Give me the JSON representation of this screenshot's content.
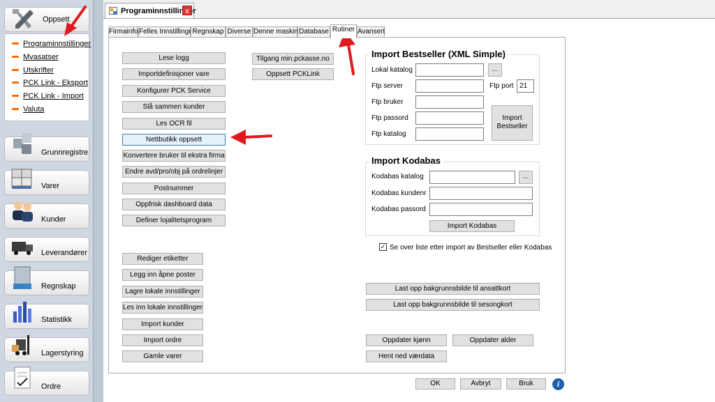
{
  "sidebar": {
    "top_button": "Oppsett",
    "submenu": [
      "Programinnstillinger",
      "Mvasatser",
      "Utskrifter",
      "PCK Link - Eksport",
      "PCK Link - Import",
      "Valuta"
    ],
    "nav": [
      "Grunnregistre",
      "Varer",
      "Kunder",
      "Leverandører",
      "Regnskap",
      "Statistikk",
      "Lagerstyring",
      "Ordre"
    ]
  },
  "document_tab": {
    "title": "Programinnstillinger",
    "close": "x"
  },
  "tabs": [
    "Firmainfo",
    "Felles Innstillinger",
    "Regnskap",
    "Diverse",
    "Denne maskin",
    "Database",
    "Rutiner",
    "Avansert"
  ],
  "active_tab": "Rutiner",
  "left_buttons": [
    "Lese logg",
    "Importdefinisjoner vare",
    "Konfigurer PCK Service",
    "Slå sammen kunder",
    "Les OCR fil",
    "Nettbutikk oppsett",
    "Konvertere bruker til ekstra firma",
    "Endre avd/pro/obj på ordrelinjer",
    "Postnummer",
    "Oppfrisk dashboard data",
    "Definer lojalitetsprogram"
  ],
  "left_buttons2": [
    "Rediger etiketter",
    "Legg inn åpne poster",
    "Lagre lokale innstillinger",
    "Les inn  lokale innstillinger",
    "Import kunder",
    "Import ordre",
    "Gamle varer"
  ],
  "mid_buttons": [
    "Tilgang min.pckasse.no",
    "Oppsett PCKLink"
  ],
  "bestseller": {
    "title": "Import Bestseller (XML Simple)",
    "lokal_katalog": "Lokal katalog",
    "browse": "...",
    "ftp_server": "Ftp server",
    "ftp_port_label": "Ftp port",
    "ftp_port_value": "21",
    "ftp_bruker": "Ftp bruker",
    "ftp_passord": "Ftp passord",
    "ftp_katalog": "Ftp katalog",
    "import_button": "Import Bestseller"
  },
  "kodabas": {
    "title": "Import Kodabas",
    "katalog": "Kodabas katalog",
    "browse": "...",
    "kundenr": "Kodabas kundenr",
    "passord": "Kodabas passord",
    "import_button": "Import Kodabas"
  },
  "checkbox_label": "Se over liste etter import av Bestseller eller Kodabas",
  "right_buttons": [
    "Last opp bakgrunnsbilde til ansattkort",
    "Last opp bakgrunnsbilde til sesongkort"
  ],
  "bottom_buttons": [
    "Oppdater kjønn",
    "Oppdater alder",
    "Hent ned værdata"
  ],
  "footer": {
    "ok": "OK",
    "avbryt": "Avbryt",
    "bruk": "Bruk",
    "info": "i"
  },
  "colors": {
    "arrow": "#e0191e",
    "accent_dash": "#ff6a00",
    "info_icon": "#1a5fa8"
  }
}
